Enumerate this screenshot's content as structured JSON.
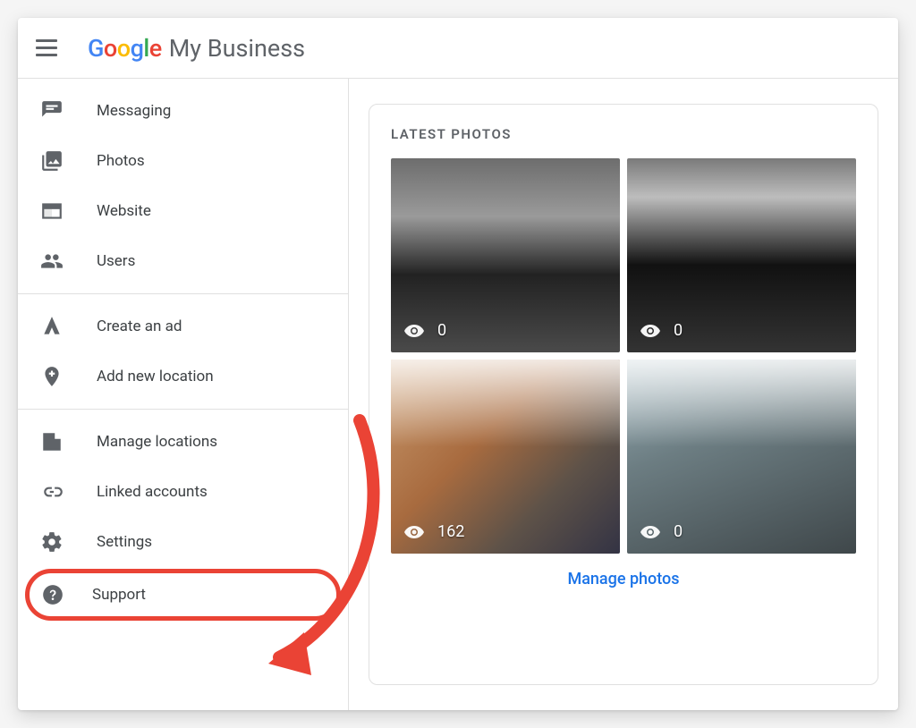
{
  "header": {
    "app_name": "My Business"
  },
  "sidebar": {
    "group1": [
      {
        "key": "messaging",
        "label": "Messaging",
        "icon": "chat-icon"
      },
      {
        "key": "photos",
        "label": "Photos",
        "icon": "photos-icon"
      },
      {
        "key": "website",
        "label": "Website",
        "icon": "website-icon"
      },
      {
        "key": "users",
        "label": "Users",
        "icon": "users-icon"
      }
    ],
    "group2": [
      {
        "key": "create-ad",
        "label": "Create an ad",
        "icon": "ads-icon"
      },
      {
        "key": "add-location",
        "label": "Add new location",
        "icon": "add-location-icon"
      }
    ],
    "group3": [
      {
        "key": "manage-locations",
        "label": "Manage locations",
        "icon": "building-icon"
      },
      {
        "key": "linked-accounts",
        "label": "Linked accounts",
        "icon": "link-icon"
      },
      {
        "key": "settings",
        "label": "Settings",
        "icon": "gear-icon"
      },
      {
        "key": "support",
        "label": "Support",
        "icon": "help-icon",
        "highlighted": true
      }
    ]
  },
  "main": {
    "card_title": "LATEST PHOTOS",
    "photos": [
      {
        "views": "0"
      },
      {
        "views": "0"
      },
      {
        "views": "162"
      },
      {
        "views": "0"
      }
    ],
    "manage_link": "Manage photos"
  },
  "annotation": {
    "arrow_color": "#EA4335"
  }
}
